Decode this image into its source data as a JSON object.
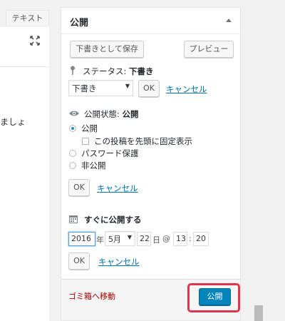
{
  "editor": {
    "text_tab": "テキスト",
    "body_text_fragment": "ましょ"
  },
  "publish_box": {
    "title": "公開",
    "save_draft_label": "下書きとして保存",
    "preview_label": "プレビュー",
    "status": {
      "label": "ステータス:",
      "value": "下書き",
      "select_value": "下書き",
      "ok_label": "OK",
      "cancel_label": "キャンセル"
    },
    "visibility": {
      "label": "公開状態:",
      "value": "公開",
      "options": [
        {
          "label": "公開",
          "checked": true
        },
        {
          "label": "パスワード保護",
          "checked": false
        },
        {
          "label": "非公開",
          "checked": false
        }
      ],
      "sticky_label": "この投稿を先頭に固定表示",
      "ok_label": "OK",
      "cancel_label": "キャンセル"
    },
    "schedule": {
      "label": "すぐに公開する",
      "year": "2016",
      "year_suffix": "年",
      "month": "5月",
      "day": "22",
      "day_suffix": "日",
      "at": "@",
      "hour": "13",
      "colon": ":",
      "minute": "20",
      "ok_label": "OK",
      "cancel_label": "キャンセル"
    },
    "trash_label": "ゴミ箱へ移動",
    "publish_label": "公開"
  },
  "colors": {
    "primary_button": "#0085ba",
    "link": "#0073aa",
    "trash": "#aa0000",
    "highlight": "#e0344f"
  }
}
